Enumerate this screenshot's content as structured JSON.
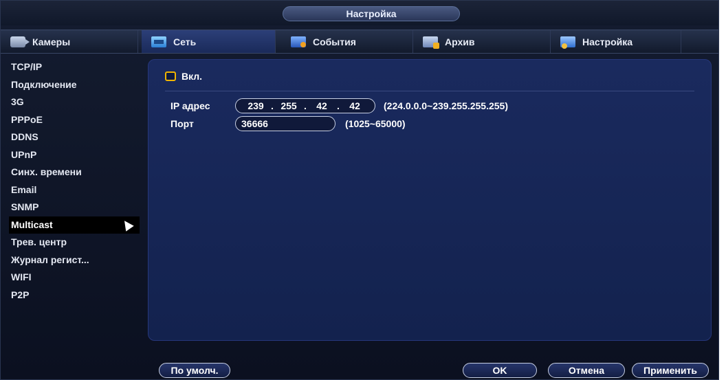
{
  "window": {
    "title": "Настройка"
  },
  "tabs": [
    {
      "label": "Камеры",
      "icon": "camera-icon"
    },
    {
      "label": "Сеть",
      "icon": "network-icon",
      "active": true
    },
    {
      "label": "События",
      "icon": "events-icon"
    },
    {
      "label": "Архив",
      "icon": "archive-icon"
    },
    {
      "label": "Настройка",
      "icon": "settings-icon"
    }
  ],
  "sidebar": {
    "items": [
      {
        "label": "TCP/IP"
      },
      {
        "label": "Подключение"
      },
      {
        "label": "3G"
      },
      {
        "label": "PPPoE"
      },
      {
        "label": "DDNS"
      },
      {
        "label": "UPnP"
      },
      {
        "label": "Синх. времени"
      },
      {
        "label": "Email"
      },
      {
        "label": "SNMP"
      },
      {
        "label": "Multicast",
        "active": true
      },
      {
        "label": "Трев. центр"
      },
      {
        "label": "Журнал регист..."
      },
      {
        "label": "WIFI"
      },
      {
        "label": "P2P"
      }
    ]
  },
  "form": {
    "enable_label": "Вкл.",
    "enable_checked": false,
    "ip_label": "IP адрес",
    "ip_octets": [
      "239",
      "255",
      "42",
      "42"
    ],
    "ip_range": "(224.0.0.0~239.255.255.255)",
    "port_label": "Порт",
    "port_value": "36666",
    "port_range": "(1025~65000)"
  },
  "buttons": {
    "default": "По умолч.",
    "ok": "OK",
    "cancel": "Отмена",
    "apply": "Применить"
  },
  "colors": {
    "panel": "#1a2a5e",
    "active_tab": "#2c3f78",
    "checkbox_border": "#f0b400"
  }
}
